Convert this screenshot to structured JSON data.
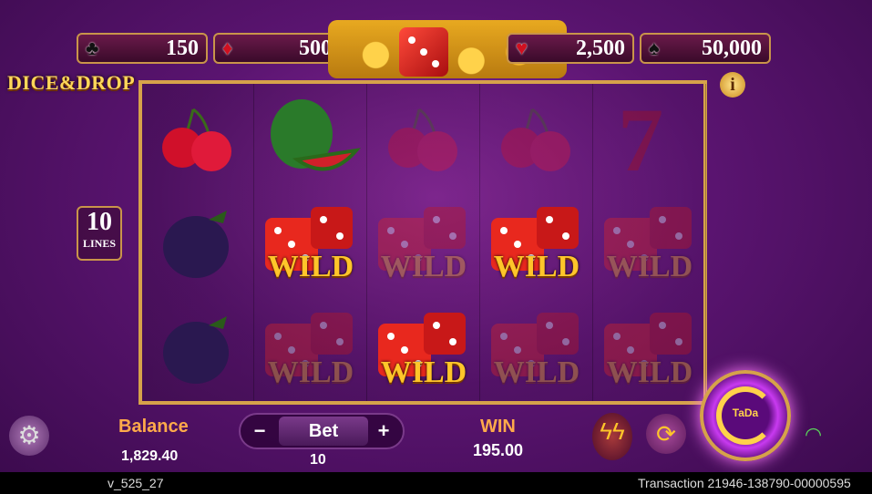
{
  "jackpots": [
    {
      "suit": "club-icon",
      "glyph": "♣",
      "value": "150",
      "red": false
    },
    {
      "suit": "diamond-icon",
      "glyph": "♦",
      "value": "500",
      "red": true
    },
    {
      "suit": "heart-icon",
      "glyph": "♥",
      "value": "2,500",
      "red": true
    },
    {
      "suit": "spade-icon",
      "glyph": "♠",
      "value": "50,000",
      "red": false
    }
  ],
  "logo": "DICE&DROP",
  "info_glyph": "i",
  "lines": {
    "count": "10",
    "label": "LINES"
  },
  "reels": [
    [
      "cherry",
      "plum",
      "plum"
    ],
    [
      "watermelon",
      "wild",
      "wild-dim"
    ],
    [
      "cherry-dim",
      "wild-dim",
      "wild"
    ],
    [
      "cherry-dim",
      "wild",
      "wild-dim"
    ],
    [
      "seven-dim",
      "wild-dim",
      "wild-dim"
    ]
  ],
  "wild_text": "WILD",
  "balance": {
    "label": "Balance",
    "value": "1,829.40"
  },
  "bet": {
    "label": "Bet",
    "value": "10",
    "minus": "−",
    "plus": "+"
  },
  "win": {
    "label": "WIN",
    "value": "195.00"
  },
  "spin_label": "TaDa",
  "footer": {
    "version": "v_525_27",
    "transaction": "Transaction 21946-138790-00000595"
  }
}
